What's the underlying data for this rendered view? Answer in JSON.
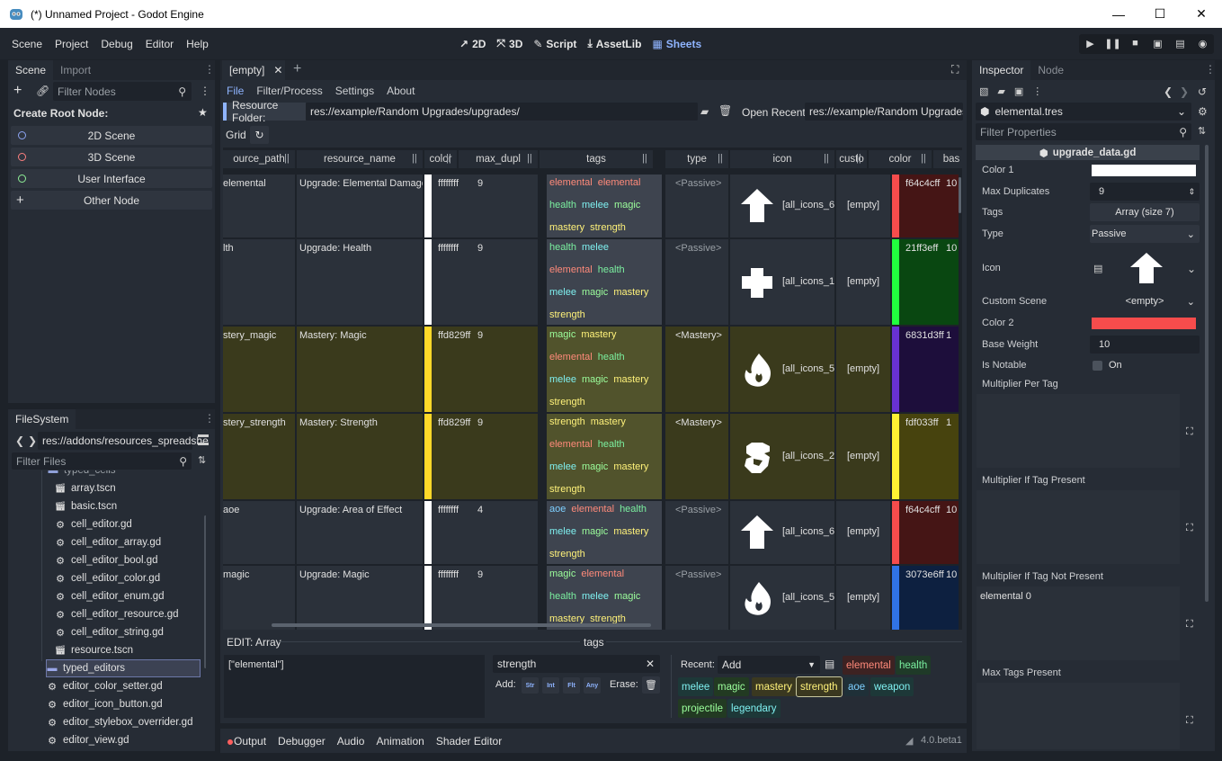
{
  "window": {
    "title": "(*) Unnamed Project - Godot Engine"
  },
  "menu": [
    "Scene",
    "Project",
    "Debug",
    "Editor",
    "Help"
  ],
  "workspaces": [
    "2D",
    "3D",
    "Script",
    "AssetLib",
    "Sheets"
  ],
  "scene_panel": {
    "tabs": [
      "Scene",
      "Import"
    ],
    "filter_placeholder": "Filter Nodes",
    "create_root_label": "Create Root Node:",
    "root_buttons": [
      "2D Scene",
      "3D Scene",
      "User Interface",
      "Other Node"
    ],
    "root_colors": [
      "#8da5f3",
      "#fc7f7f",
      "#8eef97",
      "#e0e0e0"
    ]
  },
  "filesystem": {
    "tab": "FileSystem",
    "path": "res://addons/resources_spreadshe",
    "filter_placeholder": "Filter Files",
    "partial_top": "typed_cells",
    "items": [
      {
        "name": "array.tscn",
        "type": "scene",
        "indent": 1
      },
      {
        "name": "basic.tscn",
        "type": "scene",
        "indent": 1
      },
      {
        "name": "cell_editor.gd",
        "type": "script",
        "indent": 1
      },
      {
        "name": "cell_editor_array.gd",
        "type": "script",
        "indent": 1
      },
      {
        "name": "cell_editor_bool.gd",
        "type": "script",
        "indent": 1
      },
      {
        "name": "cell_editor_color.gd",
        "type": "script",
        "indent": 1
      },
      {
        "name": "cell_editor_enum.gd",
        "type": "script",
        "indent": 1
      },
      {
        "name": "cell_editor_resource.gd",
        "type": "script",
        "indent": 1
      },
      {
        "name": "cell_editor_string.gd",
        "type": "script",
        "indent": 1
      },
      {
        "name": "resource.tscn",
        "type": "scene",
        "indent": 1
      },
      {
        "name": "typed_editors",
        "type": "folder",
        "indent": 0
      },
      {
        "name": "editor_color_setter.gd",
        "type": "script",
        "indent": 0
      },
      {
        "name": "editor_icon_button.gd",
        "type": "script",
        "indent": 0
      },
      {
        "name": "editor_stylebox_overrider.gd",
        "type": "script",
        "indent": 0
      },
      {
        "name": "editor_view.gd",
        "type": "script",
        "indent": 0
      }
    ]
  },
  "sheets": {
    "tab": "[empty]",
    "menus": [
      "File",
      "Filter/Process",
      "Settings",
      "About"
    ],
    "resource_folder_label": "Resource Folder:",
    "resource_folder": "res://example/Random Upgrades/upgrades/",
    "open_recent_label": "Open Recent:",
    "open_recent": "res://example/Random Upgrades/u",
    "grid_label": "Grid",
    "columns": [
      "ource_path",
      "resource_name",
      "color",
      "max_dupl",
      "tags",
      "type",
      "icon",
      "custo",
      "color",
      "bas"
    ],
    "rows": [
      {
        "path": "elemental",
        "name": "Upgrade: Elemental Damage",
        "color": "ffffffff",
        "color_hex": "#ffffff",
        "max": "9",
        "tags": [
          [
            "elemental",
            "elem"
          ],
          [
            "elemental",
            "elem"
          ],
          [
            "health",
            "health"
          ],
          [
            "melee",
            "melee"
          ],
          [
            "magic",
            "magic"
          ],
          [
            "mastery",
            "mastery"
          ],
          [
            "strength",
            "strength"
          ]
        ],
        "type": "<Passive>",
        "icon": "[all_icons_6]",
        "icon_shape": "arrow",
        "custom": "[empty]",
        "color2": "f64c4cff",
        "color2_hex": "#f64c4c",
        "base": "10",
        "highlight": false
      },
      {
        "path": "lth",
        "name": "Upgrade: Health",
        "color": "ffffffff",
        "color_hex": "#ffffff",
        "max": "9",
        "tags": [
          [
            "health",
            "health"
          ],
          [
            "melee",
            "melee"
          ],
          [
            "elemental",
            "elem"
          ],
          [
            "health",
            "health"
          ],
          [
            "melee",
            "melee"
          ],
          [
            "magic",
            "magic"
          ],
          [
            "mastery",
            "mastery"
          ],
          [
            "strength",
            "strength"
          ]
        ],
        "type": "<Passive>",
        "icon": "[all_icons_1]",
        "icon_shape": "cross",
        "custom": "[empty]",
        "color2": "21ff3eff",
        "color2_hex": "#21ff3e",
        "base": "10",
        "highlight": false
      },
      {
        "path": "stery_magic",
        "name": "Mastery: Magic",
        "color": "ffd829ff",
        "color_hex": "#ffd829",
        "max": "9",
        "tags": [
          [
            "magic",
            "magic"
          ],
          [
            "mastery",
            "mastery"
          ],
          [
            "elemental",
            "elem"
          ],
          [
            "health",
            "health"
          ],
          [
            "melee",
            "melee"
          ],
          [
            "magic",
            "magic"
          ],
          [
            "mastery",
            "mastery"
          ],
          [
            "strength",
            "strength"
          ]
        ],
        "type": "<Mastery>",
        "icon": "[all_icons_5]",
        "icon_shape": "flame",
        "custom": "[empty]",
        "color2": "6831d3ff",
        "color2_hex": "#6831d3",
        "base": "1",
        "highlight": true
      },
      {
        "path": "stery_strength",
        "name": "Mastery: Strength",
        "color": "ffd829ff",
        "color_hex": "#ffd829",
        "max": "9",
        "tags": [
          [
            "strength",
            "strength"
          ],
          [
            "mastery",
            "mastery"
          ],
          [
            "elemental",
            "elem"
          ],
          [
            "health",
            "health"
          ],
          [
            "melee",
            "melee"
          ],
          [
            "magic",
            "magic"
          ],
          [
            "mastery",
            "mastery"
          ],
          [
            "strength",
            "strength"
          ]
        ],
        "type": "<Mastery>",
        "icon": "[all_icons_2]",
        "icon_shape": "fist",
        "custom": "[empty]",
        "color2": "fdf033ff",
        "color2_hex": "#fdf033",
        "base": "1",
        "highlight": true
      },
      {
        "path": "aoe",
        "name": "Upgrade: Area of Effect",
        "color": "ffffffff",
        "color_hex": "#ffffff",
        "max": "4",
        "tags": [
          [
            "aoe",
            "aoe"
          ],
          [
            "elemental",
            "elem"
          ],
          [
            "health",
            "health"
          ],
          [
            "melee",
            "melee"
          ],
          [
            "magic",
            "magic"
          ],
          [
            "mastery",
            "mastery"
          ],
          [
            "strength",
            "strength"
          ]
        ],
        "type": "<Passive>",
        "icon": "[all_icons_6]",
        "icon_shape": "arrow",
        "custom": "[empty]",
        "color2": "f64c4cff",
        "color2_hex": "#f64c4c",
        "base": "10",
        "highlight": false
      },
      {
        "path": "magic",
        "name": "Upgrade: Magic",
        "color": "ffffffff",
        "color_hex": "#ffffff",
        "max": "9",
        "tags": [
          [
            "magic",
            "magic"
          ],
          [
            "elemental",
            "elem"
          ],
          [
            "health",
            "health"
          ],
          [
            "melee",
            "melee"
          ],
          [
            "magic",
            "magic"
          ],
          [
            "mastery",
            "mastery"
          ],
          [
            "strength",
            "strength"
          ]
        ],
        "type": "<Passive>",
        "icon": "[all_icons_5]",
        "icon_shape": "flame",
        "custom": "[empty]",
        "color2": "3073e6ff",
        "color2_hex": "#3073e6",
        "base": "10",
        "highlight": false
      }
    ],
    "edit_label": "EDIT: Array",
    "edit_column": "tags",
    "edit_value": "[\"elemental\"]",
    "edit_input": "strength",
    "add_label": "Add:",
    "add_types": [
      "Str",
      "Int",
      "Flt",
      "Any"
    ],
    "erase_label": "Erase:",
    "recent_label": "Recent:",
    "recent_select": "Add",
    "recent_tags": [
      {
        "label": "elemental",
        "color": "#ff8a7a",
        "bg": "#3d2222"
      },
      {
        "label": "health",
        "color": "#7bf0a0",
        "bg": "#1f3a28"
      },
      {
        "label": "melee",
        "color": "#7ff0f0",
        "bg": "#1d3838"
      },
      {
        "label": "magic",
        "color": "#9cff9c",
        "bg": "#223a22"
      },
      {
        "label": "mastery",
        "color": "#fff27a",
        "bg": "#3a3820"
      },
      {
        "label": "strength",
        "color": "#fff27a",
        "bg": "#3a3820"
      },
      {
        "label": "aoe",
        "color": "#7ecfff",
        "bg": "#1f3038"
      },
      {
        "label": "weapon",
        "color": "#7ff0f0",
        "bg": "#1d3838"
      },
      {
        "label": "projectile",
        "color": "#9cff9c",
        "bg": "#223a22"
      },
      {
        "label": "legendary",
        "color": "#7ff0f0",
        "bg": "#1d3838"
      }
    ]
  },
  "bottom": {
    "tabs": [
      "Output",
      "Debugger",
      "Audio",
      "Animation",
      "Shader Editor"
    ],
    "version": "4.0.beta1"
  },
  "inspector": {
    "tabs": [
      "Inspector",
      "Node"
    ],
    "resource": "elemental.tres",
    "filter_placeholder": "Filter Properties",
    "script": "upgrade_data.gd",
    "props": {
      "color1_label": "Color 1",
      "max_dup_label": "Max Duplicates",
      "max_dup": "9",
      "tags_label": "Tags",
      "tags": "Array (size 7)",
      "type_label": "Type",
      "type": "Passive",
      "icon_label": "Icon",
      "custom_scene_label": "Custom Scene",
      "custom_scene": "<empty>",
      "color2_label": "Color 2",
      "base_weight_label": "Base Weight",
      "base_weight": "10",
      "is_notable_label": "Is Notable",
      "is_notable": "On",
      "mult_per_tag_label": "Multiplier Per Tag",
      "mult_if_present_label": "Multiplier If Tag Present",
      "mult_if_not_present_label": "Multiplier If Tag Not Present",
      "mult_if_not_present_value": "elemental 0",
      "max_tags_label": "Max Tags Present"
    },
    "color1": "#ffffff",
    "color2": "#f64c4c"
  }
}
